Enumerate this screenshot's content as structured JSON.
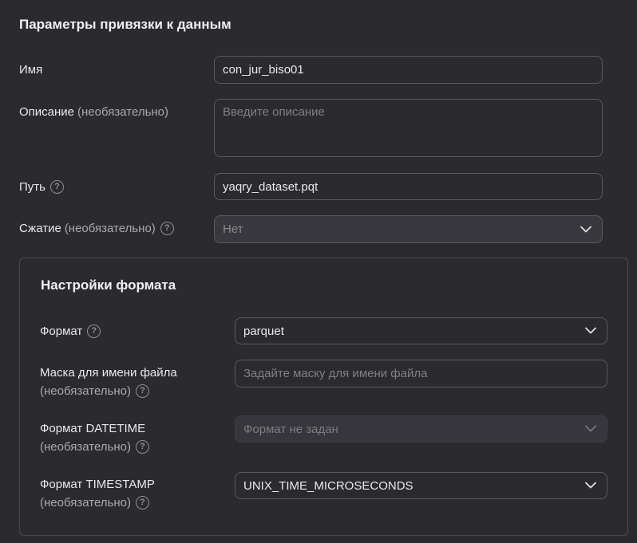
{
  "binding": {
    "title": "Параметры привязки к данным",
    "name_label": "Имя",
    "name_value": "con_jur_biso01",
    "description_label": "Описание",
    "optional": "(необязательно)",
    "description_placeholder": "Введите описание",
    "path_label": "Путь",
    "path_value": "yaqry_dataset.pqt",
    "compression_label": "Сжатие",
    "compression_value": "Нет"
  },
  "format_settings": {
    "title": "Настройки формата",
    "format_label": "Формат",
    "format_value": "parquet",
    "mask_label": "Маска для имени файла",
    "mask_placeholder": "Задайте маску для имени файла",
    "datetime_label": "Формат DATETIME",
    "datetime_value": "Формат не задан",
    "timestamp_label": "Формат TIMESTAMP",
    "timestamp_value": "UNIX_TIME_MICROSECONDS"
  },
  "icons": {
    "help": "help-circle-icon",
    "chevron": "chevron-down-icon"
  }
}
